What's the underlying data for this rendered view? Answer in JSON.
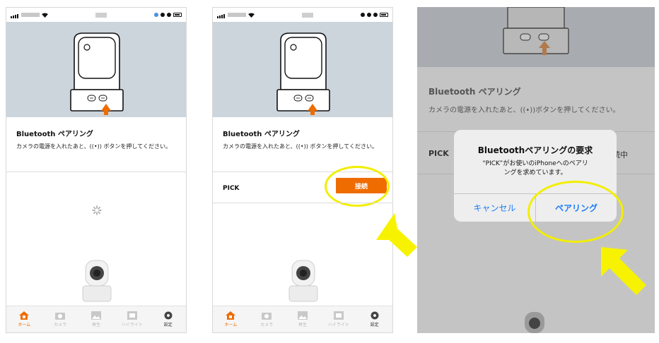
{
  "colors": {
    "accent": "#ef6c00",
    "highlight": "#f2ee00",
    "link": "#1a7cf5",
    "hero_bg": "#cdd5dc"
  },
  "screen1": {
    "section_title": "Bluetooth ペアリング",
    "section_desc": "カメラの電源を入れたあと、((•)) ボタンを押してください。",
    "tabs": [
      {
        "label": "ホーム",
        "icon": "home-icon"
      },
      {
        "label": "カメラ",
        "icon": "camera-icon"
      },
      {
        "label": "再生",
        "icon": "image-icon"
      },
      {
        "label": "ハイライト",
        "icon": "highlight-icon"
      },
      {
        "label": "設定",
        "icon": "gear-icon"
      }
    ]
  },
  "screen2": {
    "section_title": "Bluetooth ペアリング",
    "section_desc": "カメラの電源を入れたあと、((•)) ボタンを押してください。",
    "device_name": "PICK",
    "connect_label": "接続",
    "tabs": [
      {
        "label": "ホーム",
        "icon": "home-icon"
      },
      {
        "label": "カメラ",
        "icon": "camera-icon"
      },
      {
        "label": "再生",
        "icon": "image-icon"
      },
      {
        "label": "ハイライト",
        "icon": "highlight-icon"
      },
      {
        "label": "設定",
        "icon": "gear-icon"
      }
    ]
  },
  "screen3": {
    "section_title": "Bluetooth ペアリング",
    "section_desc": "カメラの電源を入れたあと、((•))ボタンを押してください。",
    "device_name": "PICK",
    "status_text": "続中",
    "alert": {
      "title": "Bluetoothペアリングの要求",
      "message_line1": "“PICK”がお使いのiPhoneへのペアリ",
      "message_line2": "ングを求めています。",
      "cancel_label": "キャンセル",
      "confirm_label": "ペアリング"
    }
  }
}
